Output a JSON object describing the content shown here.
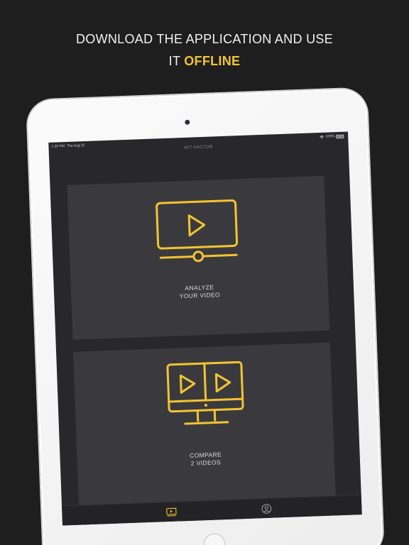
{
  "promo": {
    "line1": "DOWNLOAD THE APPLICATION AND USE",
    "line2_prefix": "IT ",
    "line2_accent": "OFFLINE"
  },
  "statusbar": {
    "time": "1:30 PM",
    "date": "Thu Aug 22",
    "battery": "100%"
  },
  "nav": {
    "title": "HIT FACTOR"
  },
  "cards": [
    {
      "line1": "ANALYZE",
      "line2": "YOUR VIDEO",
      "icon": "play-video-icon"
    },
    {
      "line1": "COMPARE",
      "line2": "2 VIDEOS",
      "icon": "compare-videos-icon"
    }
  ],
  "tabbar": {
    "items": [
      {
        "icon": "video-tab-icon",
        "selected": true
      },
      {
        "icon": "profile-tab-icon",
        "selected": false
      }
    ]
  },
  "colors": {
    "accent": "#f4c430",
    "background": "#1e1e1e",
    "card": "#3a3a3e",
    "screen": "#28282b"
  }
}
